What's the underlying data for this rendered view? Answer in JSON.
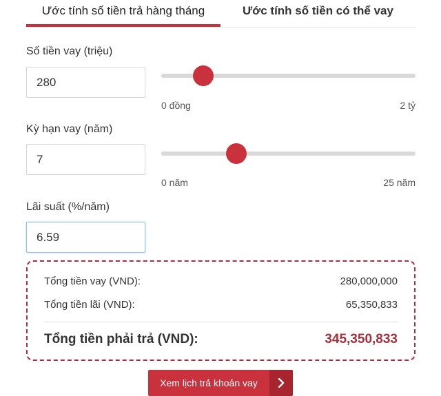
{
  "tabs": [
    {
      "label": "Ước tính số tiền trả hàng tháng",
      "active": true
    },
    {
      "label": "Ước tính số tiền có thể vay",
      "active": false
    }
  ],
  "loan_amount": {
    "label": "Số tiền vay (triệu)",
    "value": "280",
    "slider": {
      "min_label": "0 đồng",
      "max_label": "2 tỷ",
      "fraction": 0.165
    }
  },
  "loan_term": {
    "label": "Kỳ hạn vay (năm)",
    "value": "7",
    "slider": {
      "min_label": "0 năm",
      "max_label": "25 năm",
      "fraction": 0.295
    }
  },
  "interest_rate": {
    "label": "Lãi suất (%/năm)",
    "value": "6.59"
  },
  "summary": {
    "total_loan_label": "Tổng tiền vay (VND):",
    "total_loan_value": "280,000,000",
    "total_interest_label": "Tổng tiền lãi (VND):",
    "total_interest_value": "65,350,833",
    "total_payable_label": "Tổng tiền phải trả (VND):",
    "total_payable_value": "345,350,833"
  },
  "schedule_button": {
    "label": "Xem lịch trả khoản vay"
  },
  "colors": {
    "accent": "#c9313d",
    "accent_dark": "#a8303d",
    "track": "#d9d9d9",
    "focus_border": "#8ec1e6"
  },
  "icons": {
    "button_arrow": "chevron-right-icon"
  }
}
